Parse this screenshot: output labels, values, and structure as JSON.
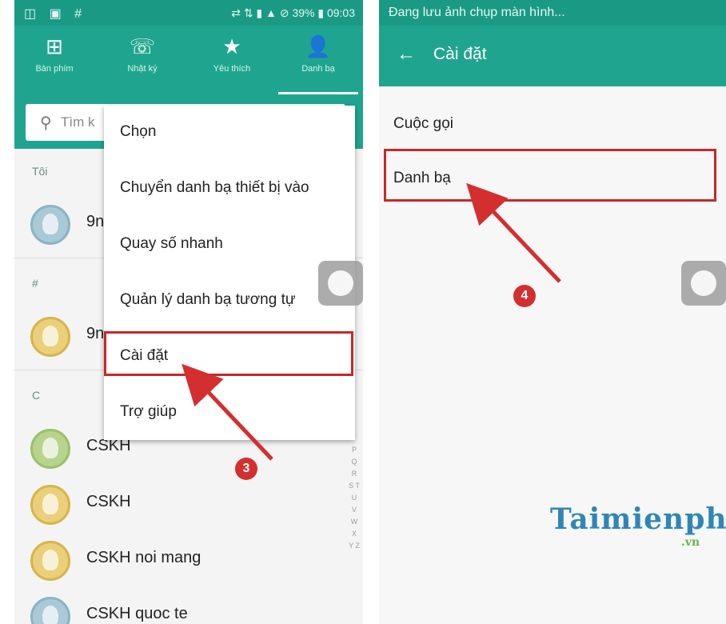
{
  "left": {
    "statusbar": {
      "left_icons": "◫ ▣ #",
      "right": "⇄ ⇅ ▮ ▲ ⊘ 39% ▮ 09:03"
    },
    "tabs": [
      {
        "icon": "keypad-icon",
        "glyph": "⊞",
        "label": "Bàn phím"
      },
      {
        "icon": "call-log-icon",
        "glyph": "☏",
        "label": "Nhật ký"
      },
      {
        "icon": "star-icon",
        "glyph": "★",
        "label": "Yêu thích"
      },
      {
        "icon": "person-icon",
        "glyph": "👤",
        "label": "Danh bạ"
      }
    ],
    "search_placeholder": "Tìm k",
    "sections": {
      "me": "Tôi",
      "hash": "#",
      "c": "C"
    },
    "contacts": [
      {
        "name": "9n",
        "avatar": "blue"
      },
      {
        "name": "9n",
        "avatar": "yellow"
      },
      {
        "name": "CSKH",
        "avatar": "green"
      },
      {
        "name": "CSKH",
        "avatar": "yellow"
      },
      {
        "name": "CSKH noi mang",
        "avatar": "yellow"
      },
      {
        "name": "CSKH quoc te",
        "avatar": "blue"
      }
    ],
    "alphabet": "P Q R S T U V W X Y Z",
    "menu": [
      "Chọn",
      "Chuyển danh bạ thiết bị vào",
      "Quay số nhanh",
      "Quản lý danh bạ tương tự",
      "Cài đặt",
      "Trợ giúp"
    ],
    "step_badge": "3"
  },
  "right": {
    "statusbar": "Đang lưu ảnh chụp màn hình...",
    "title": "Cài đặt",
    "items": [
      "Cuộc gọi",
      "Danh bạ"
    ],
    "step_badge": "4"
  },
  "watermark": {
    "main": "Taimienphi",
    "sub": ".vn"
  },
  "colors": {
    "accent": "#1fa58f",
    "highlight": "#c62828",
    "arrow": "#d32f2f"
  }
}
